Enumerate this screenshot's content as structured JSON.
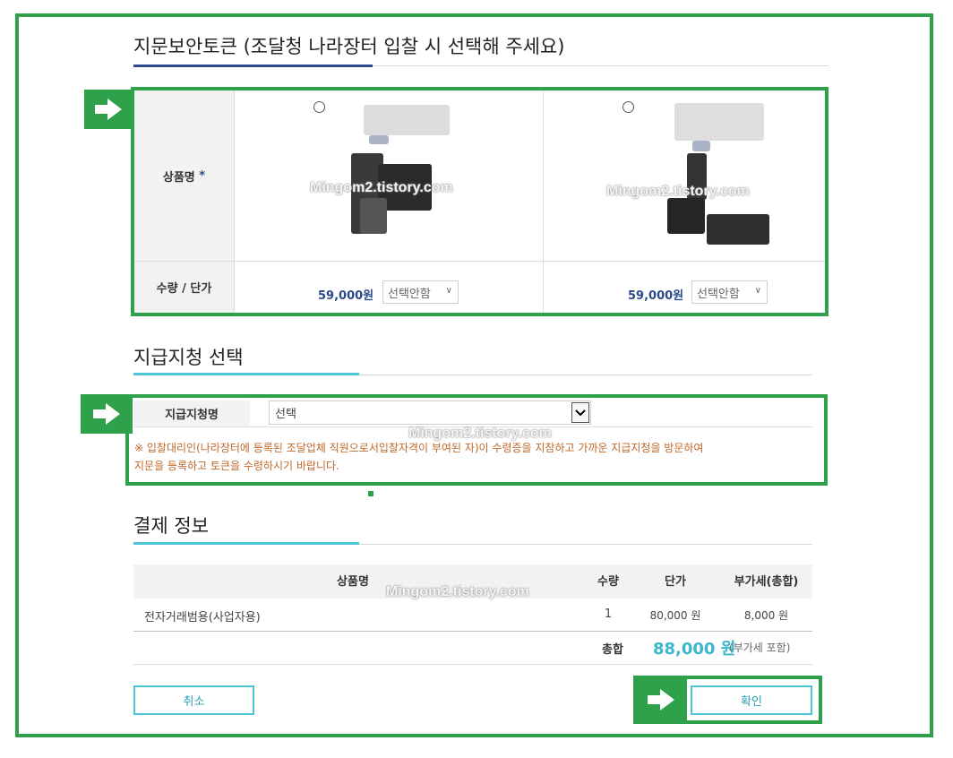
{
  "token_section": {
    "title": "지문보안토큰 (조달청 나라장터 입찰 시 선택해 주세요)",
    "product_label": "상품명",
    "required_mark": "*",
    "qty_label": "수량 / 단가",
    "watermark": "Mingom2.tistory.com",
    "products": [
      {
        "price": "59,000원",
        "select_value": "선택안함"
      },
      {
        "price": "59,000원",
        "select_value": "선택안함"
      }
    ]
  },
  "branch_section": {
    "title": "지급지청 선택",
    "label": "지급지청명",
    "select_value": "선택",
    "watermark": "Mingom2.tistory.com",
    "notice_line1": "※ 입찰대리인(나라장터에 등록된 조달업체 직원으로서입찰자격이 부여된 자)이 수령증을 지참하고 가까운 지급지청을 방문하여",
    "notice_line2": "지문을 등록하고 토큰을 수령하시기 바랍니다."
  },
  "payment_section": {
    "title": "결제 정보",
    "watermark": "Mingom2.tistory.com",
    "headers": {
      "name": "상품명",
      "qty": "수량",
      "price": "단가",
      "vat": "부가세(총합)"
    },
    "row": {
      "name": "전자거래범용(사업자용)",
      "qty": "1",
      "price": "80,000 원",
      "vat": "8,000 원"
    },
    "total_label": "총합",
    "total_amount": "88,000 원",
    "total_note": "(부가세 포함)"
  },
  "buttons": {
    "cancel": "취소",
    "confirm": "확인"
  },
  "colors": {
    "annotation_green": "#2fa14a",
    "accent_cyan": "#4fc3d6",
    "accent_navy": "#2c4a8a",
    "notice_orange": "#c0682a"
  }
}
